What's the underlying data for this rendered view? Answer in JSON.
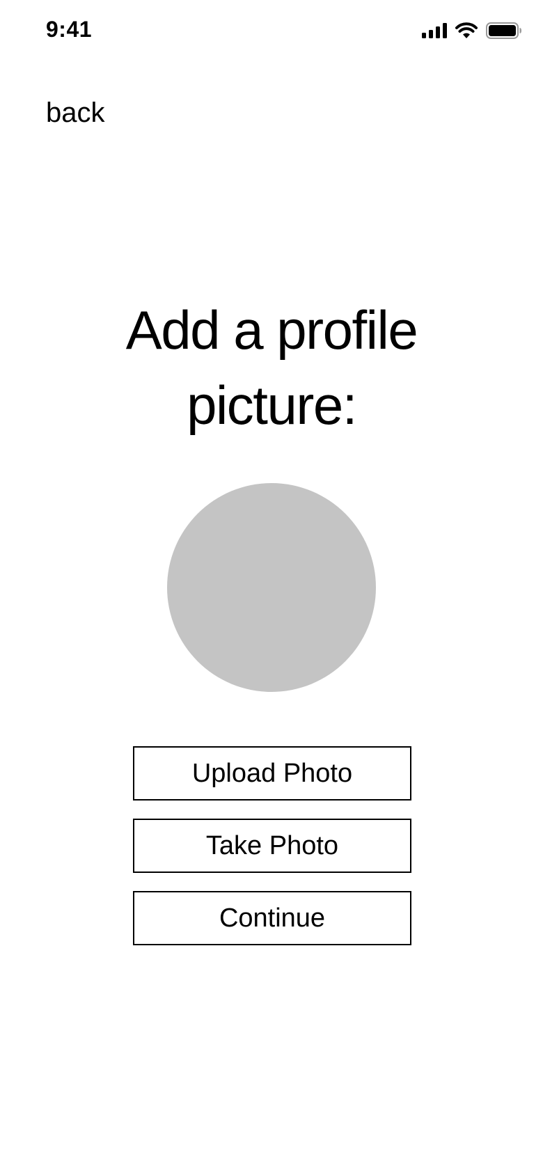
{
  "status_bar": {
    "time": "9:41",
    "icons": [
      "cellular-signal-icon",
      "wifi-icon",
      "battery-icon"
    ]
  },
  "nav": {
    "back_label": "back"
  },
  "main": {
    "title_line1": "Add a profile",
    "title_line2": "picture:",
    "avatar_placeholder_color": "#c4c4c4"
  },
  "actions": {
    "upload_label": "Upload Photo",
    "take_label": "Take Photo",
    "continue_label": "Continue"
  }
}
